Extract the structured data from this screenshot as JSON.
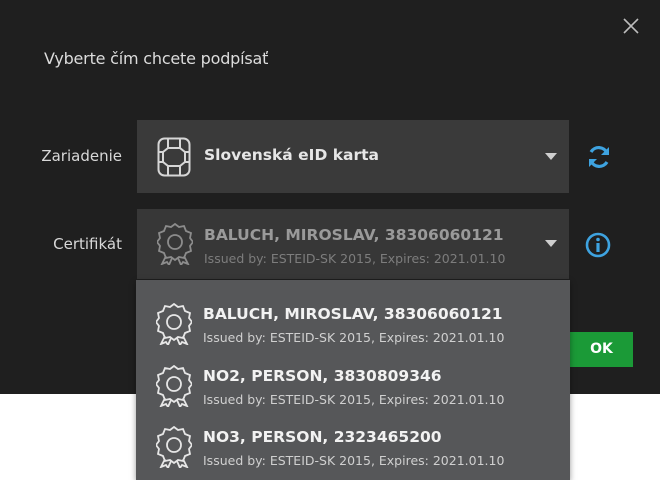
{
  "dialog": {
    "title": "Vyberte čím chcete podpísať"
  },
  "device": {
    "label": "Zariadenie",
    "selected": "Slovenská eID karta",
    "icon": "smartcard-chip-icon",
    "refresh_icon": "refresh-icon"
  },
  "certificate": {
    "label": "Certifikát",
    "selected": {
      "name": "BALUCH, MIROSLAV, 38306060121",
      "issuer": "Issued by: ESTEID-SK 2015, Expires: 2021.01.10"
    },
    "info_icon": "info-icon",
    "options": [
      {
        "name": "BALUCH, MIROSLAV, 38306060121",
        "issuer": "Issued by: ESTEID-SK 2015, Expires: 2021.01.10"
      },
      {
        "name": "NO2, PERSON, 3830809346",
        "issuer": "Issued by: ESTEID-SK 2015, Expires: 2021.01.10"
      },
      {
        "name": "NO3, PERSON, 2323465200",
        "issuer": "Issued by: ESTEID-SK 2015, Expires: 2021.01.10"
      }
    ]
  },
  "ok_button": {
    "label": "OK"
  },
  "colors": {
    "dialog_bg": "#1f1f1f",
    "select_bg": "#3a3a3a",
    "dropdown_bg": "#565759",
    "accent_blue": "#3ea3e0",
    "ok_green": "#1b9a37"
  }
}
